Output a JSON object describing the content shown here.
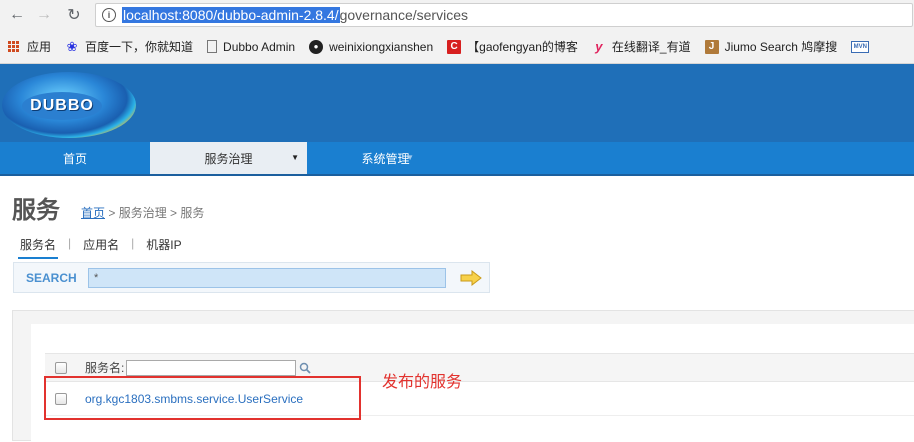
{
  "browser": {
    "url_selected": "localhost:8080/dubbo-admin-2.8.4/",
    "url_rest": "governance/services",
    "bookmarks": [
      {
        "label": "应用",
        "icon": "apps-icon"
      },
      {
        "label": "百度一下，你就知道",
        "icon": "baidu-icon"
      },
      {
        "label": "Dubbo Admin",
        "icon": "page-icon"
      },
      {
        "label": "weinixiongxianshen",
        "icon": "github-icon"
      },
      {
        "label": "【gaofengyan的博客",
        "icon": "csdn-icon"
      },
      {
        "label": "在线翻译_有道",
        "icon": "youdao-icon"
      },
      {
        "label": "Jiumo Search 鸠摩搜",
        "icon": "jiumo-icon"
      }
    ],
    "mvn_badge": "MVN"
  },
  "header": {
    "logo_text": "DUBBO"
  },
  "menu": {
    "home": "首页",
    "governance": "服务治理",
    "system": "系统管理"
  },
  "page": {
    "title": "服务",
    "breadcrumb_home": "首页",
    "breadcrumb_rest": " > 服务治理 > 服务"
  },
  "tabs": {
    "service_name": "服务名",
    "app_name": "应用名",
    "machine_ip": "机器IP",
    "sep": "|"
  },
  "search": {
    "label": "SEARCH",
    "value": "*"
  },
  "table": {
    "filter_label": "服务名:",
    "rows": [
      {
        "service": "org.kgc1803.smbms.service.UserService"
      }
    ]
  },
  "annotation": "发布的服务",
  "colors": {
    "header_blue": "#1f6fb8",
    "menu_blue": "#1a7fd0",
    "annotation_red": "#e2322e"
  }
}
